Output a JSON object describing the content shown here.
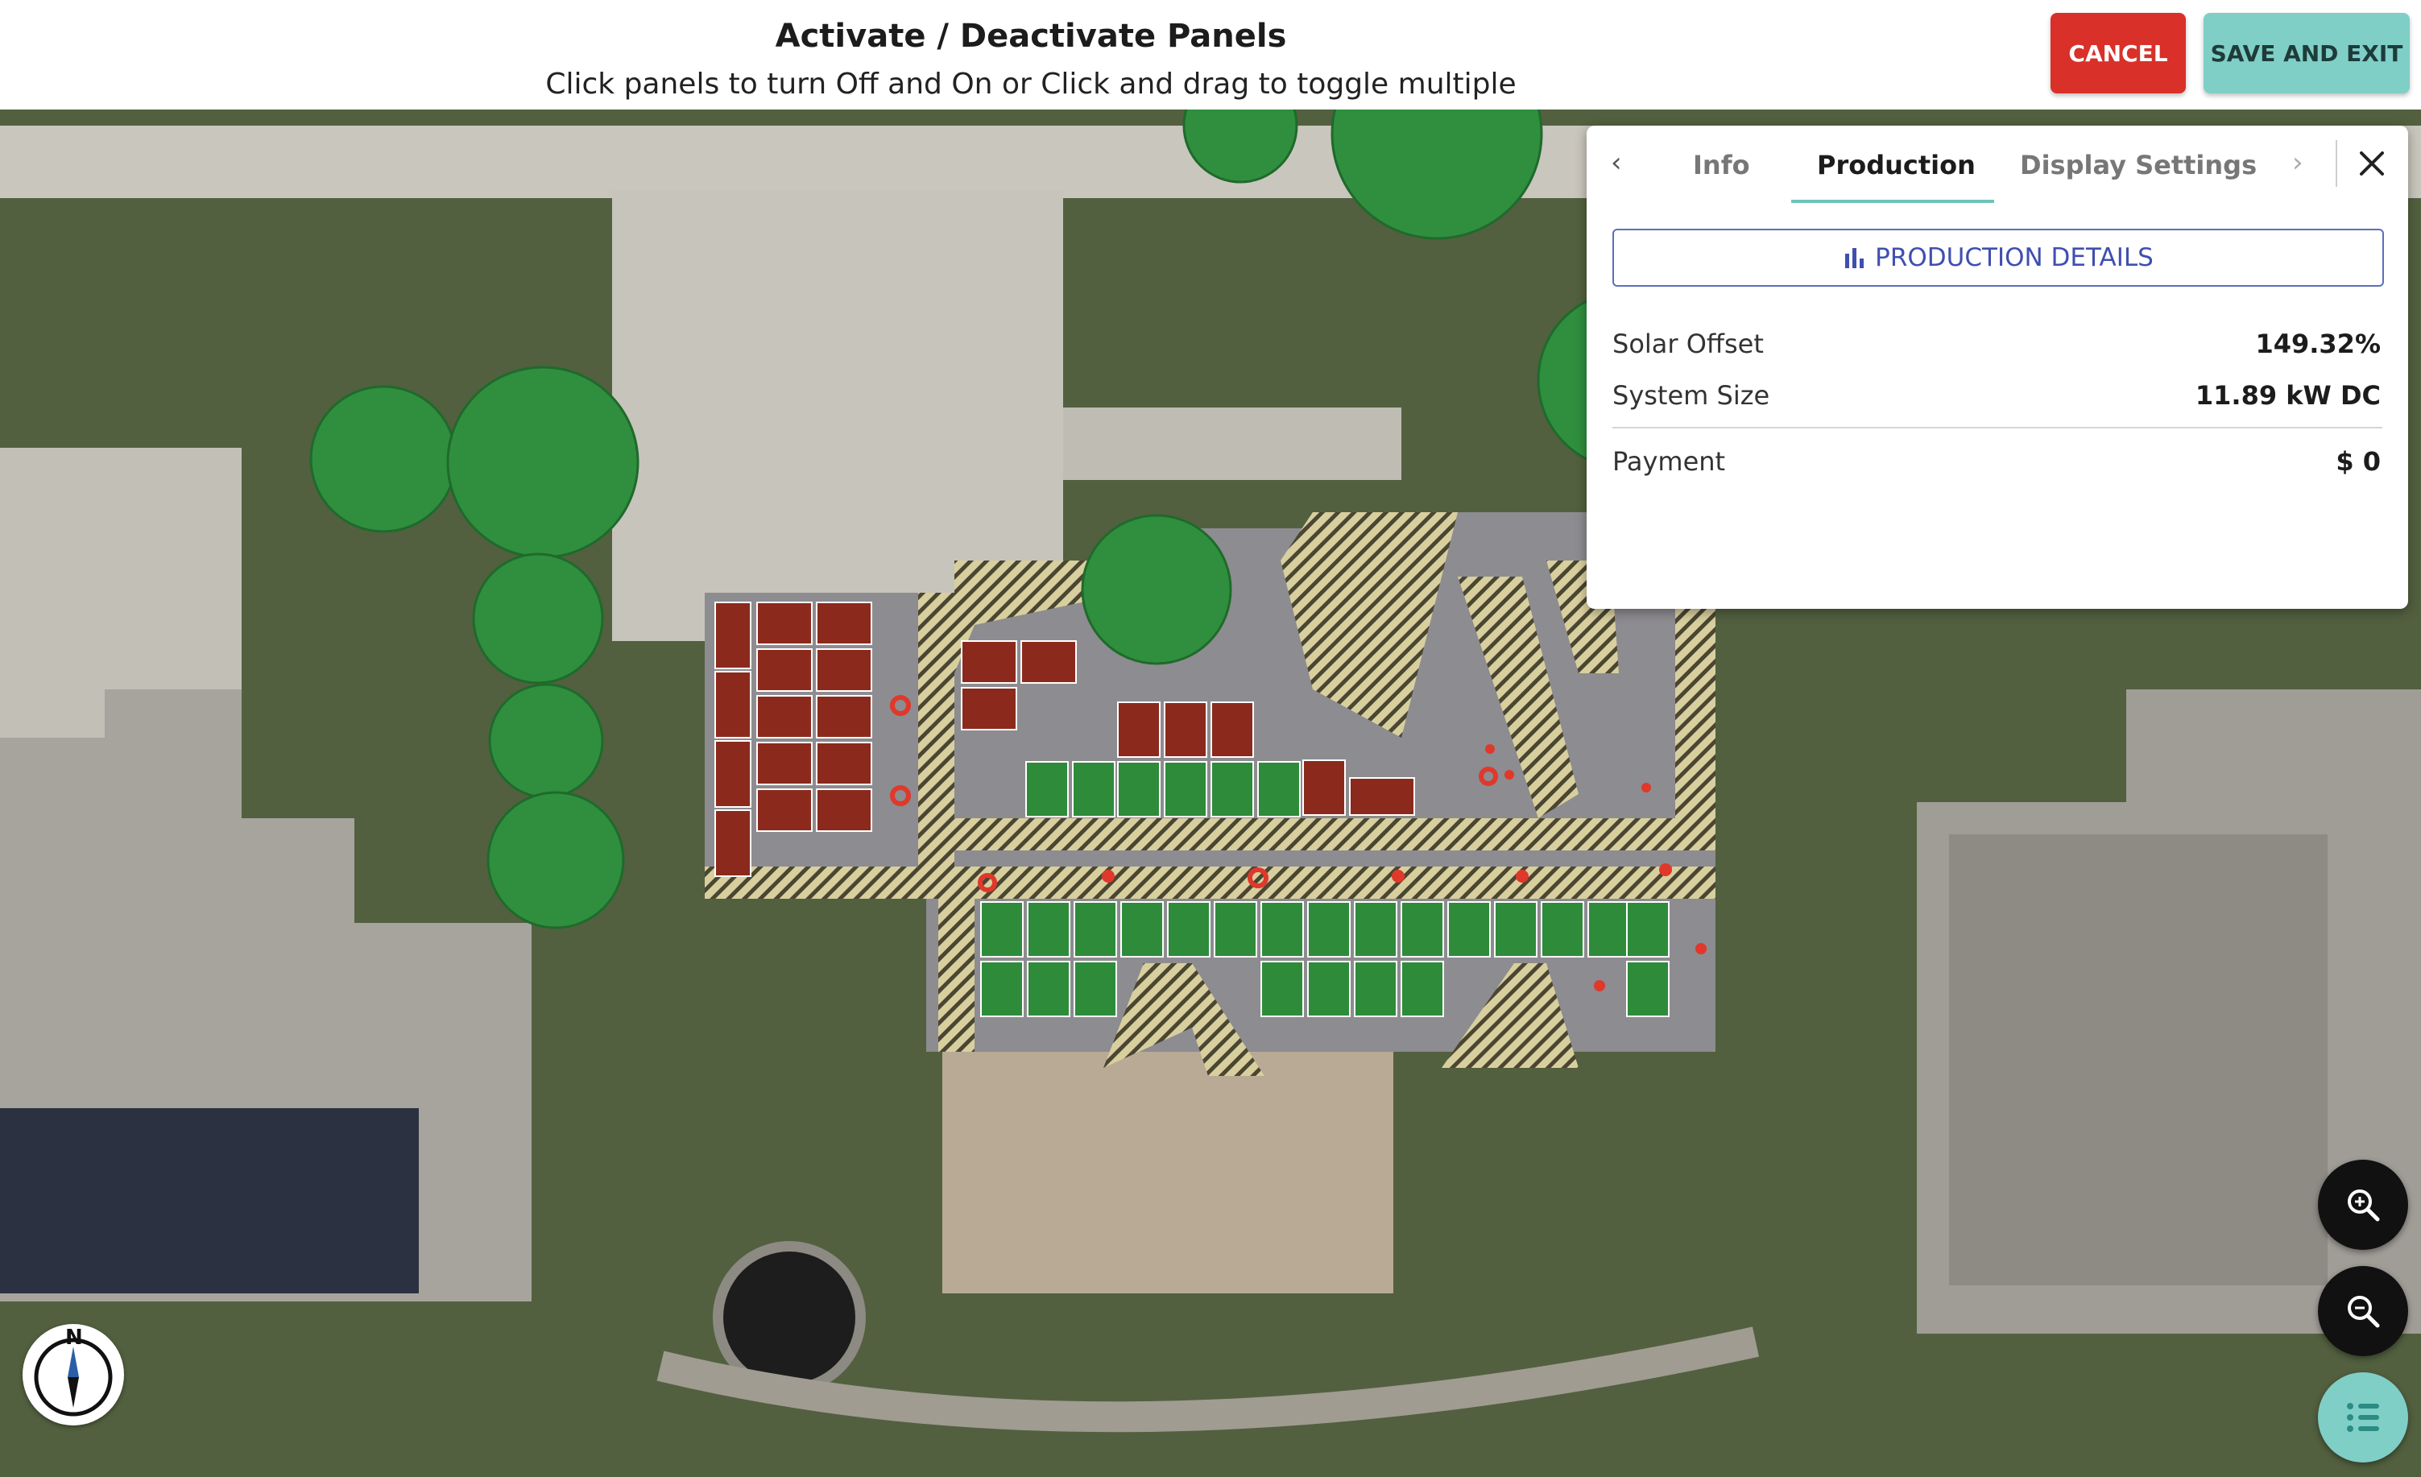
{
  "header": {
    "title": "Activate / Deactivate Panels",
    "subtitle": "Click panels to turn Off and On or Click and drag to toggle multiple",
    "cancel_label": "CANCEL",
    "save_label": "SAVE AND EXIT"
  },
  "panel": {
    "tabs": [
      "Info",
      "Production",
      "Display Settings"
    ],
    "active_tab": "Production",
    "production_button_label": "PRODUCTION DETAILS",
    "rows": [
      {
        "label": "Solar Offset",
        "value": "149.32%"
      },
      {
        "label": "System Size",
        "value": "11.89 kW DC"
      },
      {
        "label": "Payment",
        "value": "$ 0"
      }
    ]
  },
  "compass": {
    "north_label": "N"
  },
  "icons": {
    "prev": "chevron-left-icon",
    "next": "chevron-right-icon",
    "close": "close-icon",
    "bar_chart": "bar-chart-icon",
    "zoom_in": "zoom-in-icon",
    "zoom_out": "zoom-out-icon",
    "list": "list-icon",
    "compass": "compass-icon"
  },
  "colors": {
    "active_panel": "#2e8b3a",
    "inactive_panel": "#8b2a1c",
    "tree": "#2f8f3e",
    "cancel": "#d9302a",
    "save": "#7fcfc7",
    "accent": "#6fc3b9",
    "link": "#3f4fb0"
  }
}
